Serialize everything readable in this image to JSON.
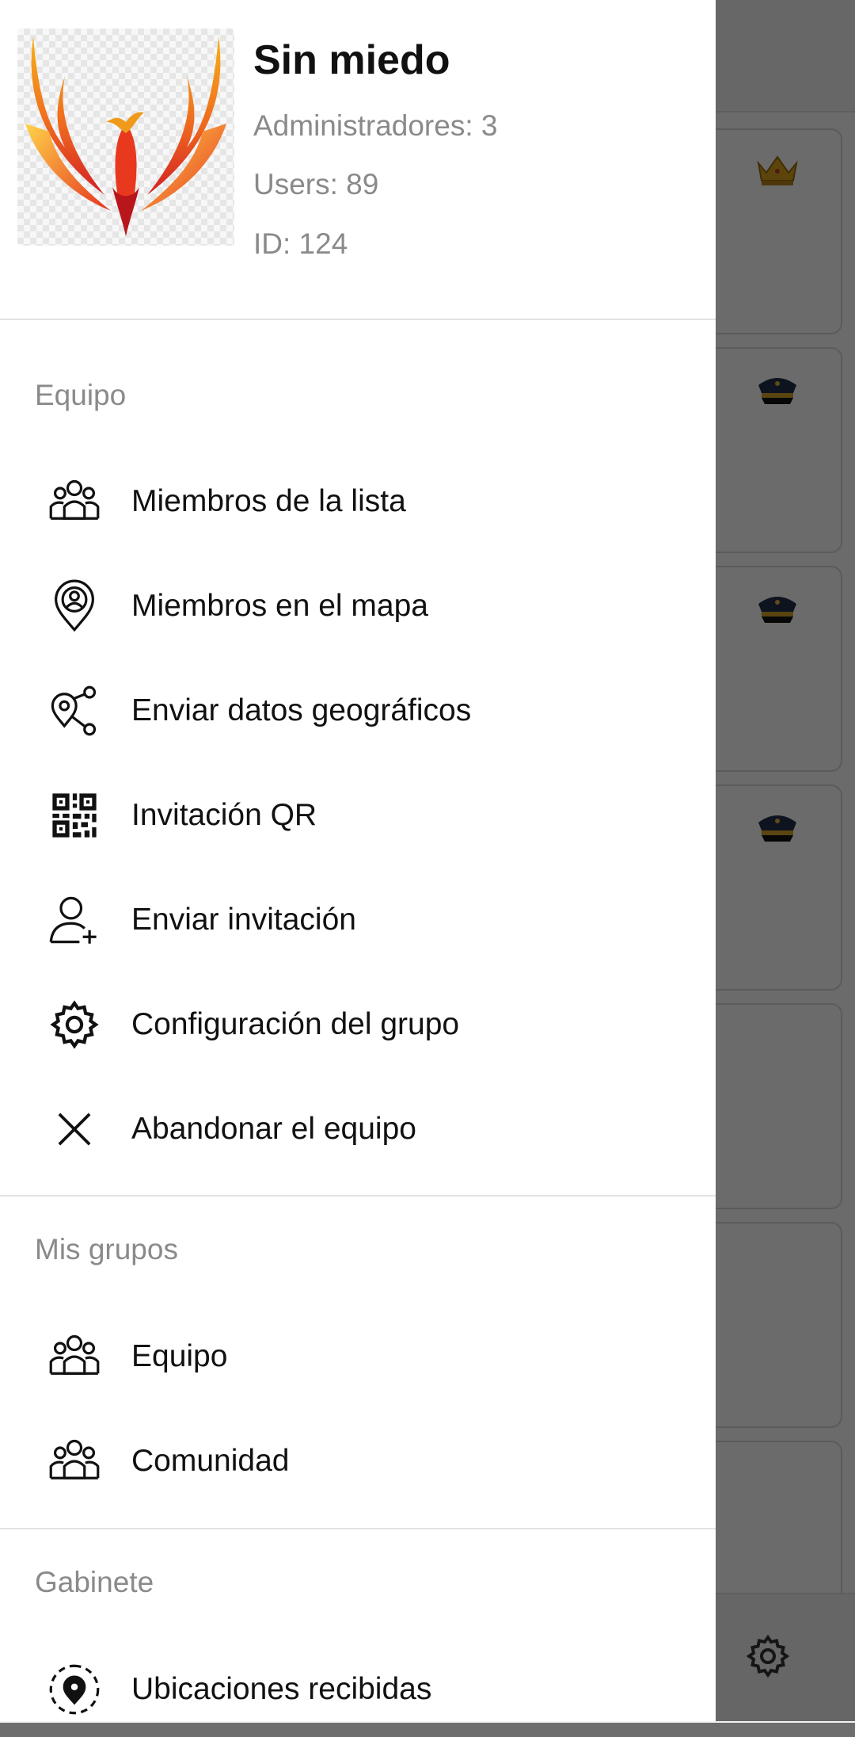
{
  "header": {
    "title": "Sin miedo",
    "admins": "Administradores: 3",
    "users": "Users: 89",
    "id": "ID: 124",
    "logo": "phoenix-logo"
  },
  "sections": {
    "equipo": {
      "title": "Equipo",
      "items": [
        {
          "label": "Miembros de la lista",
          "icon": "group-icon"
        },
        {
          "label": "Miembros en el mapa",
          "icon": "map-pin-person-icon"
        },
        {
          "label": "Enviar datos geográficos",
          "icon": "share-location-icon"
        },
        {
          "label": "Invitación QR",
          "icon": "qr-code-icon"
        },
        {
          "label": "Enviar invitación",
          "icon": "add-user-icon"
        },
        {
          "label": "Configuración del grupo",
          "icon": "gear-icon"
        },
        {
          "label": "Abandonar el equipo",
          "icon": "close-icon"
        }
      ]
    },
    "mis_grupos": {
      "title": "Mis grupos",
      "items": [
        {
          "label": "Equipo",
          "icon": "group-icon"
        },
        {
          "label": "Comunidad",
          "icon": "group-icon"
        }
      ]
    },
    "gabinete": {
      "title": "Gabinete",
      "items": [
        {
          "label": "Ubicaciones recibidas",
          "icon": "location-received-icon"
        }
      ]
    }
  },
  "background": {
    "card_icons": [
      "crown-icon",
      "police-cap-icon",
      "police-cap-icon",
      "police-cap-icon"
    ],
    "bottom_icon": "gear-icon"
  }
}
